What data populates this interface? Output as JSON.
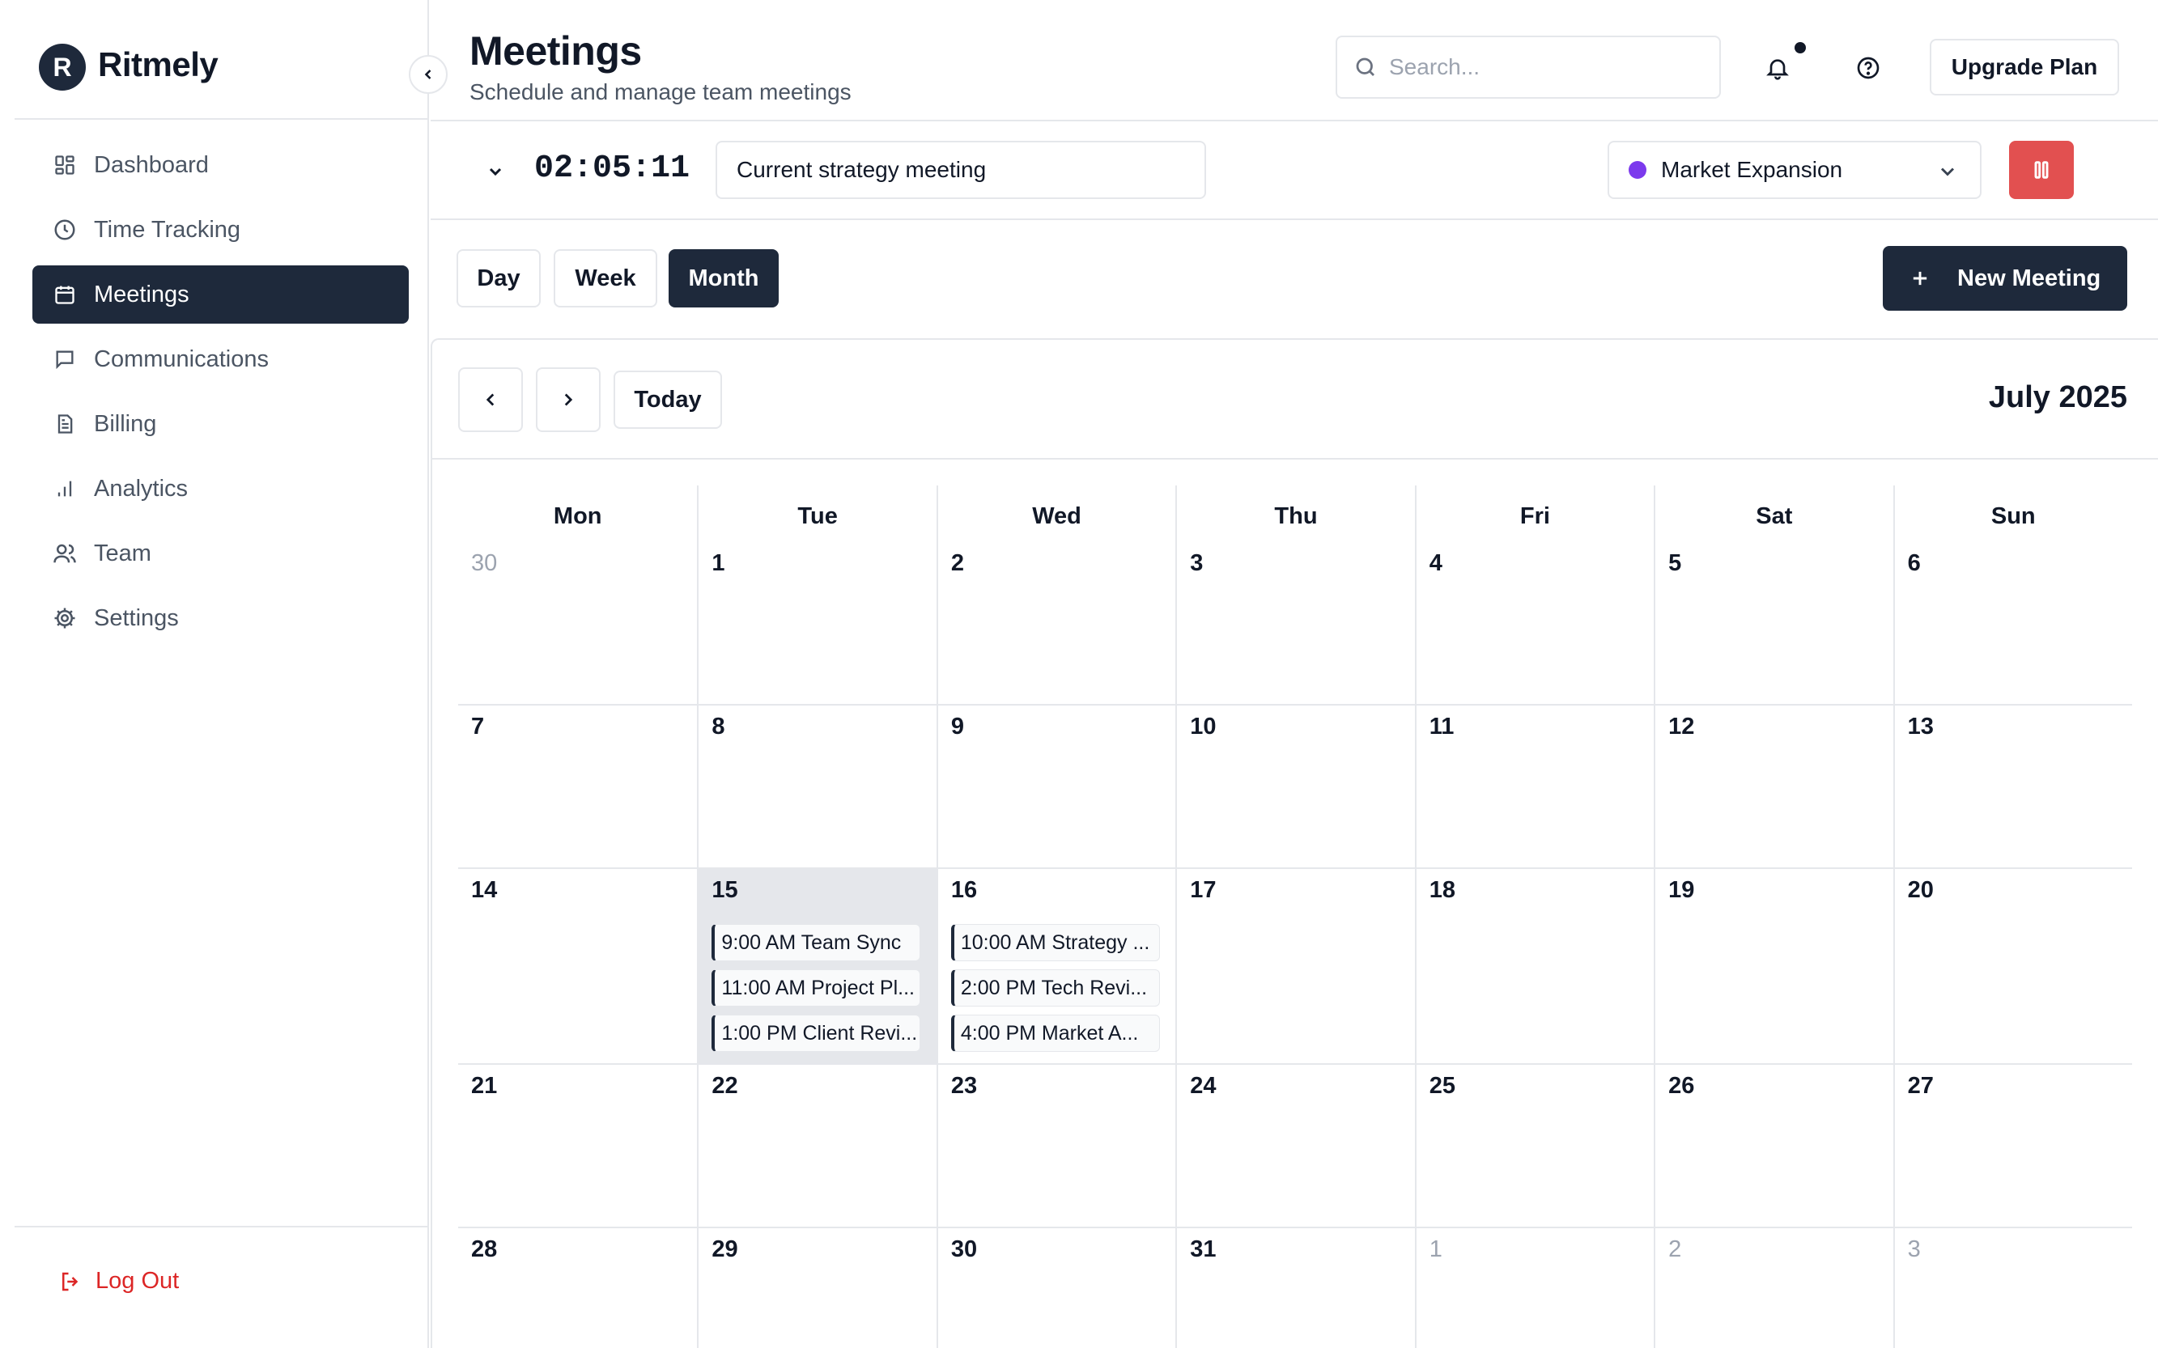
{
  "app": {
    "brand_initial": "R",
    "brand_name": "Ritmely"
  },
  "sidebar": {
    "items": [
      {
        "label": "Dashboard",
        "icon": "grid-icon",
        "active": false
      },
      {
        "label": "Time Tracking",
        "icon": "clock-icon",
        "active": false
      },
      {
        "label": "Meetings",
        "icon": "calendar-icon",
        "active": true
      },
      {
        "label": "Communications",
        "icon": "message-icon",
        "active": false
      },
      {
        "label": "Billing",
        "icon": "document-icon",
        "active": false
      },
      {
        "label": "Analytics",
        "icon": "bar-chart-icon",
        "active": false
      },
      {
        "label": "Team",
        "icon": "users-icon",
        "active": false
      },
      {
        "label": "Settings",
        "icon": "gear-icon",
        "active": false
      }
    ],
    "logout_label": "Log Out"
  },
  "header": {
    "title": "Meetings",
    "subtitle": "Schedule and manage team meetings",
    "search_placeholder": "Search...",
    "upgrade_label": "Upgrade Plan"
  },
  "timer": {
    "elapsed": "02:05:11",
    "task_value": "Current strategy meeting",
    "project_name": "Market Expansion",
    "project_color": "#7c3aed",
    "stop_color": "#e25050"
  },
  "views": {
    "options": [
      "Day",
      "Week",
      "Month"
    ],
    "active": "Month",
    "new_meeting_label": "New Meeting"
  },
  "calendar": {
    "today_label": "Today",
    "month_label": "July 2025",
    "weekdays": [
      "Mon",
      "Tue",
      "Wed",
      "Thu",
      "Fri",
      "Sat",
      "Sun"
    ],
    "weeks": [
      [
        {
          "n": "30",
          "muted": true
        },
        {
          "n": "1"
        },
        {
          "n": "2"
        },
        {
          "n": "3"
        },
        {
          "n": "4"
        },
        {
          "n": "5"
        },
        {
          "n": "6"
        }
      ],
      [
        {
          "n": "7"
        },
        {
          "n": "8"
        },
        {
          "n": "9"
        },
        {
          "n": "10"
        },
        {
          "n": "11"
        },
        {
          "n": "12"
        },
        {
          "n": "13"
        }
      ],
      [
        {
          "n": "14"
        },
        {
          "n": "15",
          "highlight": true,
          "events": [
            "9:00 AM Team Sync",
            "11:00 AM Project Pl...",
            "1:00 PM Client Revi..."
          ]
        },
        {
          "n": "16",
          "events": [
            "10:00 AM Strategy ...",
            "2:00 PM Tech Revi...",
            "4:00 PM Market A..."
          ]
        },
        {
          "n": "17"
        },
        {
          "n": "18"
        },
        {
          "n": "19"
        },
        {
          "n": "20"
        }
      ],
      [
        {
          "n": "21"
        },
        {
          "n": "22"
        },
        {
          "n": "23"
        },
        {
          "n": "24"
        },
        {
          "n": "25"
        },
        {
          "n": "26"
        },
        {
          "n": "27"
        }
      ],
      [
        {
          "n": "28"
        },
        {
          "n": "29"
        },
        {
          "n": "30"
        },
        {
          "n": "31"
        },
        {
          "n": "1",
          "muted": true
        },
        {
          "n": "2",
          "muted": true
        },
        {
          "n": "3",
          "muted": true
        }
      ]
    ]
  }
}
